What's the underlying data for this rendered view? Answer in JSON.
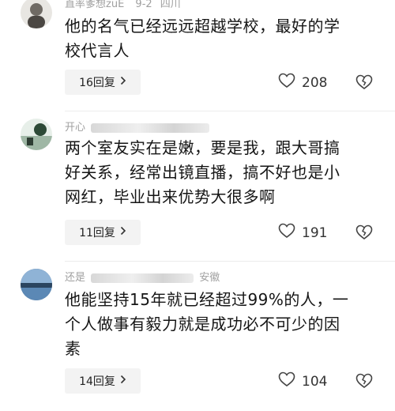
{
  "comments": [
    {
      "user": "直率爹想zuE",
      "date": "9-2",
      "location": "四川",
      "text_line1": "他的名气已经远远超越学校，最好的学",
      "text_line2": "校代言人",
      "replies": "16回复",
      "likes": "208"
    },
    {
      "user": "开心",
      "text_line1": "两个室友实在是嫩，要是我，跟大哥搞",
      "text_line2": "好关系，经常出镜直播，搞不好也是小",
      "text_line3": "网红，毕业出来优势大很多啊",
      "replies": "11回复",
      "likes": "191"
    },
    {
      "user": "还是",
      "user_suffix": "安徽",
      "text_line1": "他能坚持15年就已经超过99%的人，一",
      "text_line2": "个人做事有毅力就是成功必不可少的因",
      "text_line3": "素",
      "replies": "14回复",
      "likes": "104"
    }
  ],
  "icons": {
    "chevron": "chevron-right-icon",
    "like": "heart-outline-icon",
    "dislike": "broken-heart-icon"
  }
}
